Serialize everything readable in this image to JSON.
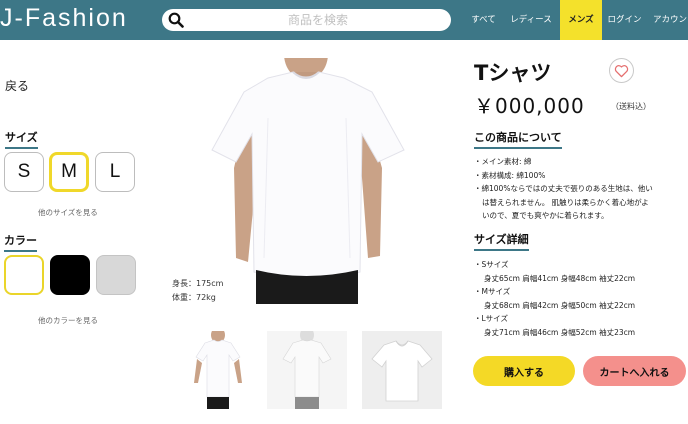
{
  "header": {
    "logo": "J-Fashion",
    "search_placeholder": "商品を検索",
    "nav": {
      "all": "すべて",
      "ladies": "レディース",
      "mens": "メンズ",
      "login": "ログイン",
      "account": "アカウント"
    }
  },
  "left": {
    "back": "戻る",
    "size_label": "サイズ",
    "sizes": [
      "S",
      "M",
      "L"
    ],
    "selected_size": "M",
    "more_sizes": "他のサイズを見る",
    "color_label": "カラー",
    "colors": [
      "#ffffff",
      "#000000",
      "#d8d8d8"
    ],
    "selected_color": "#ffffff",
    "more_colors": "他のカラーを見る"
  },
  "product": {
    "model_height": "身長：175cm",
    "model_weight": "体重：72kg",
    "title": "Tシャツ",
    "price": "￥000,000",
    "shipping": "（送料込）",
    "about_heading": "この商品について",
    "about_lines": [
      "・メイン素材: 綿",
      "・素材構成: 綿100%",
      "・綿100%ならではの丈夫で張りのある生地は、他い",
      "は替えられません。 肌触りは柔らかく着心地がよ",
      "いので、夏でも爽やかに着られます。"
    ],
    "detail_heading": "サイズ詳細",
    "size_details": [
      "・Sサイズ",
      "身丈65cm 肩幅41cm 身幅48cm 袖丈22cm",
      "・Mサイズ",
      "身丈68cm 肩幅42cm 身幅50cm 袖丈22cm",
      "・Lサイズ",
      "身丈71cm 肩幅46cm 身幅52cm 袖丈23cm"
    ],
    "buy_label": "購入する",
    "cart_label": "カートへ入れる"
  },
  "icons": {
    "search": "search-icon",
    "favorite": "heart-icon"
  },
  "colors": {
    "header_bg": "#3d7787",
    "accent_yellow": "#f4d926",
    "cart_pink": "#f4908c"
  }
}
